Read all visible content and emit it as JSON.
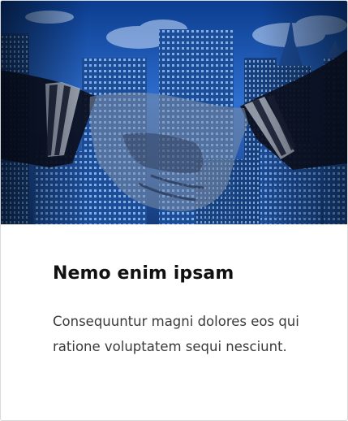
{
  "card": {
    "title": "Nemo enim ipsam",
    "description": "Consequuntur magni dolores eos qui ratione voluptatem sequi nesciunt.",
    "image": {
      "subject": "handshake-over-city-skyline",
      "colors": {
        "sky_top": "#0b3d8f",
        "sky_mid": "#2f6fd0",
        "cloud": "#cfe3ff",
        "building_dark": "#0c2250",
        "building_mid": "#1d4c98",
        "window_light": "#9fd0ff",
        "sleeve": "#0d1020",
        "skin_tint": "#7f8fa8"
      }
    }
  }
}
